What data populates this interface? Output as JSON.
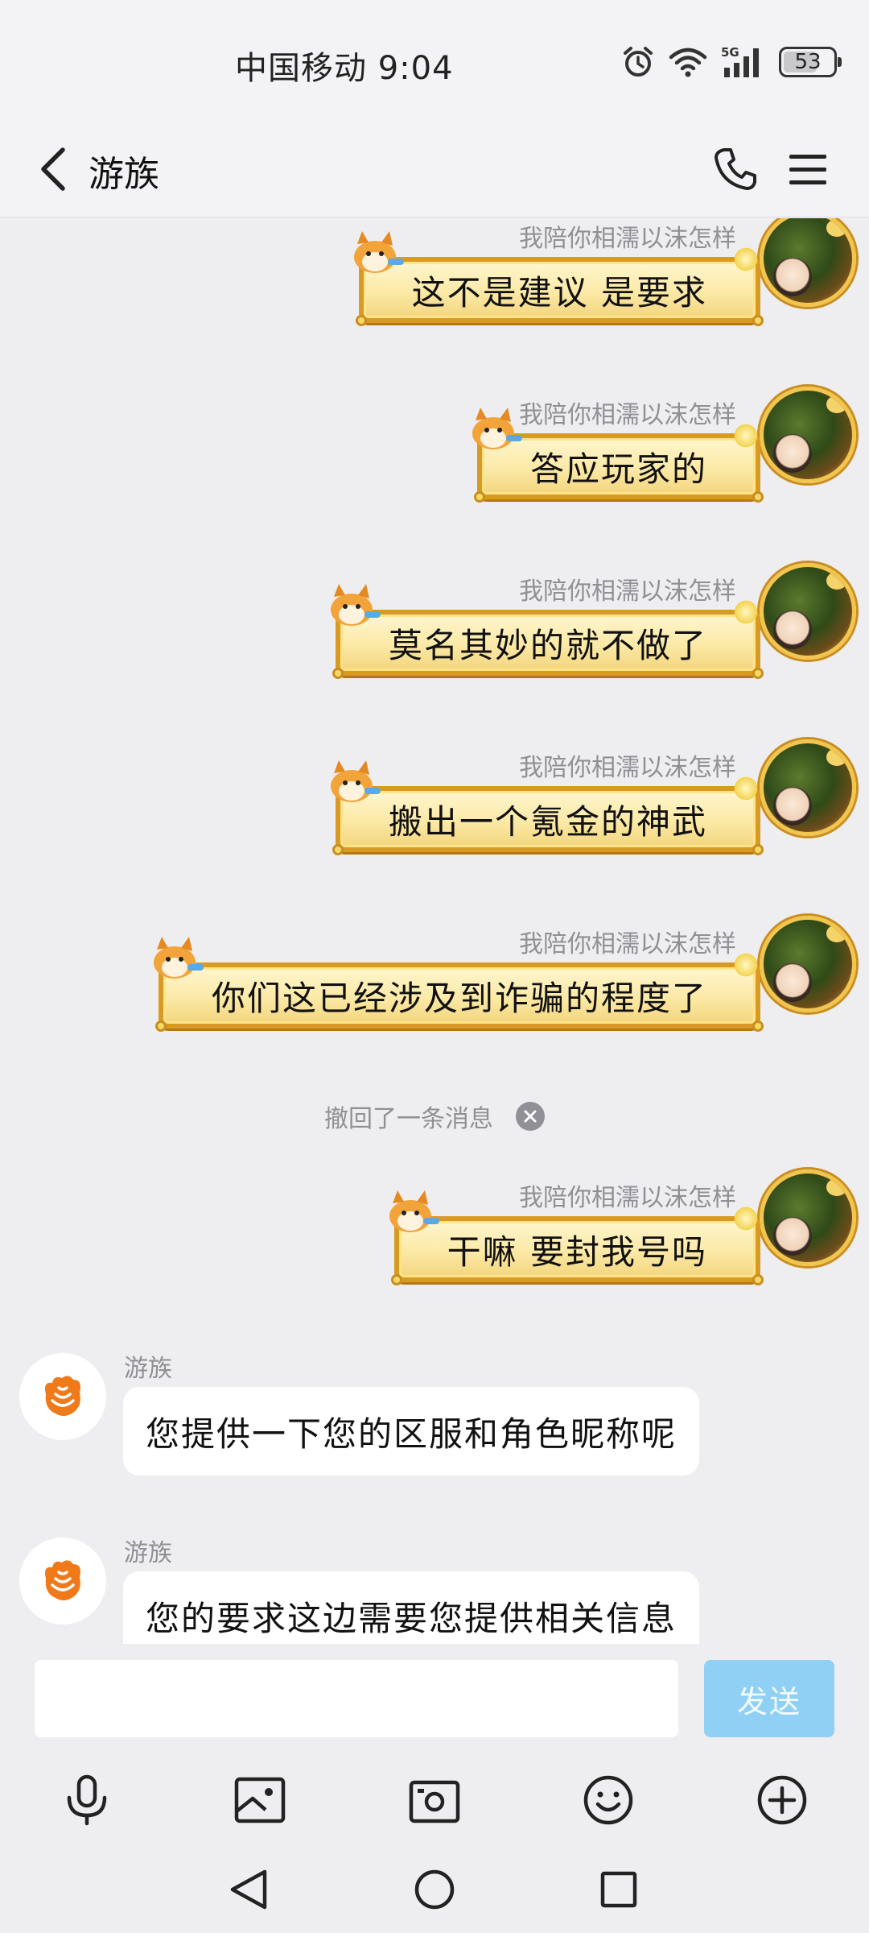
{
  "status_bar": {
    "carrier_time": "中国移动 9:04",
    "network": "5G",
    "battery": "53"
  },
  "header": {
    "title": "游族"
  },
  "messages_right": [
    {
      "sender": "我陪你相濡以沫怎样",
      "text": "这不是建议 是要求"
    },
    {
      "sender": "我陪你相濡以沫怎样",
      "text": "答应玩家的"
    },
    {
      "sender": "我陪你相濡以沫怎样",
      "text": "莫名其妙的就不做了"
    },
    {
      "sender": "我陪你相濡以沫怎样",
      "text": "搬出一个氪金的神武"
    },
    {
      "sender": "我陪你相濡以沫怎样",
      "text": "你们这已经涉及到诈骗的程度了"
    },
    {
      "sender": "我陪你相濡以沫怎样",
      "text": "干嘛 要封我号吗"
    }
  ],
  "recall_notice": "撤回了一条消息",
  "messages_left": [
    {
      "sender": "游族",
      "text": "您提供一下您的区服和角色昵称呢"
    },
    {
      "sender": "游族",
      "text": "您的要求这边需要您提供相关信息"
    }
  ],
  "input": {
    "placeholder": "",
    "send_label": "发送"
  },
  "toolbar": [
    "microphone-icon",
    "image-icon",
    "camera-icon",
    "emoji-icon",
    "plus-icon"
  ],
  "navbar": [
    "back-triangle-icon",
    "home-circle-icon",
    "recents-square-icon"
  ],
  "colors": {
    "send_button": "#90d0f5",
    "bubble_gold": "#fbe9a6",
    "brand_orange": "#f07a1a"
  }
}
